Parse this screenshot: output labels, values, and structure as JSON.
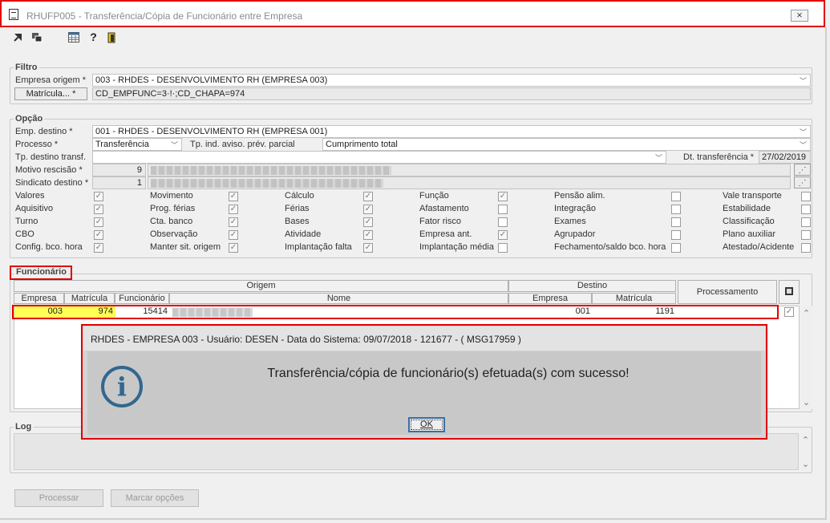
{
  "window": {
    "title": "RHUFP005 - Transferência/Cópia de Funcionário entre Empresa",
    "close_glyph": "⨯"
  },
  "toolbar": {
    "icons": [
      "arrow-import-icon",
      "copy-window-icon",
      "calendar-grid-icon",
      "help-icon",
      "exit-door-icon"
    ],
    "help_glyph": "?"
  },
  "filtro": {
    "label": "Filtro",
    "empresa_origem_label": "Empresa origem *",
    "empresa_origem_value": "003 - RHDES - DESENVOLVIMENTO RH (EMPRESA 003)",
    "matricula_button": "Matrícula... *",
    "matricula_value": "CD_EMPFUNC=3·!·;CD_CHAPA=974"
  },
  "opcao": {
    "label": "Opção",
    "emp_destino_label": "Emp. destino *",
    "emp_destino_value": "001 - RHDES - DESENVOLVIMENTO RH (EMPRESA 001)",
    "processo_label": "Processo *",
    "processo_value": "Transferência",
    "tp_ind_label": "Tp. ind. aviso. prév. parcial",
    "tp_ind_value": "Cumprimento total",
    "tp_destino_label": "Tp. destino transf.",
    "tp_destino_value": "",
    "dt_transf_label": "Dt. transferência *",
    "dt_transf_value": "27/02/2019",
    "motivo_label": "Motivo rescisão *",
    "motivo_value": "9",
    "sindicato_label": "Sindicato destino *",
    "sindicato_value": "1",
    "lookup_glyph": "⋰",
    "checkboxes": [
      {
        "label": "Valores",
        "checked": true
      },
      {
        "label": "Movimento",
        "checked": true
      },
      {
        "label": "Cálculo",
        "checked": true
      },
      {
        "label": "Função",
        "checked": true
      },
      {
        "label": "Pensão alim.",
        "checked": false
      },
      {
        "label": "Vale transporte",
        "checked": false
      },
      {
        "label": "Aquisitivo",
        "checked": true
      },
      {
        "label": "Prog. férias",
        "checked": true
      },
      {
        "label": "Férias",
        "checked": true
      },
      {
        "label": "Afastamento",
        "checked": false
      },
      {
        "label": "Integração",
        "checked": false
      },
      {
        "label": "Estabilidade",
        "checked": false
      },
      {
        "label": "Turno",
        "checked": true
      },
      {
        "label": "Cta. banco",
        "checked": true
      },
      {
        "label": "Bases",
        "checked": true
      },
      {
        "label": "Fator risco",
        "checked": false
      },
      {
        "label": "Exames",
        "checked": false
      },
      {
        "label": "Classificação",
        "checked": false
      },
      {
        "label": "CBO",
        "checked": true
      },
      {
        "label": "Observação",
        "checked": true
      },
      {
        "label": "Atividade",
        "checked": true
      },
      {
        "label": "Empresa ant.",
        "checked": true
      },
      {
        "label": "Agrupador",
        "checked": false
      },
      {
        "label": "Plano auxiliar",
        "checked": false
      },
      {
        "label": "Config. bco. hora",
        "checked": true
      },
      {
        "label": "Manter sit. origem",
        "checked": true
      },
      {
        "label": "Implantação falta",
        "checked": true
      },
      {
        "label": "Implantação média",
        "checked": false
      },
      {
        "label": "Fechamento/saldo bco. hora",
        "checked": false
      },
      {
        "label": "Atestado/Acidente",
        "checked": false
      }
    ],
    "check_glyph": "✓"
  },
  "funcionario": {
    "label": "Funcionário",
    "origem_header": "Origem",
    "destino_header": "Destino",
    "processamento_header": "Processamento",
    "columns": {
      "empresa": "Empresa",
      "matricula": "Matrícula",
      "funcionario": "Funcionário",
      "nome": "Nome",
      "dest_empresa": "Empresa",
      "dest_matricula": "Matrícula"
    },
    "row": {
      "empresa": "003",
      "matricula": "974",
      "funcionario": "15414",
      "nome": "",
      "dest_empresa": "001",
      "dest_matricula": "1191"
    },
    "scroll_up": "⌃",
    "scroll_down": "⌄"
  },
  "log": {
    "label": "Log"
  },
  "buttons": {
    "processar": "Processar",
    "marcar": "Marcar opções"
  },
  "dialog": {
    "title": "RHDES - EMPRESA 003 - Usuário: DESEN - Data do Sistema: 09/07/2018 - 121677 - ( MSG17959 )",
    "message": "Transferência/cópia de funcionário(s) efetuada(s) com sucesso!",
    "ok": "OK",
    "icon_glyph": "i"
  },
  "colors": {
    "highlight_yellow": "#ffff55",
    "annotation_red": "#e30000",
    "info_blue": "#31678f"
  }
}
